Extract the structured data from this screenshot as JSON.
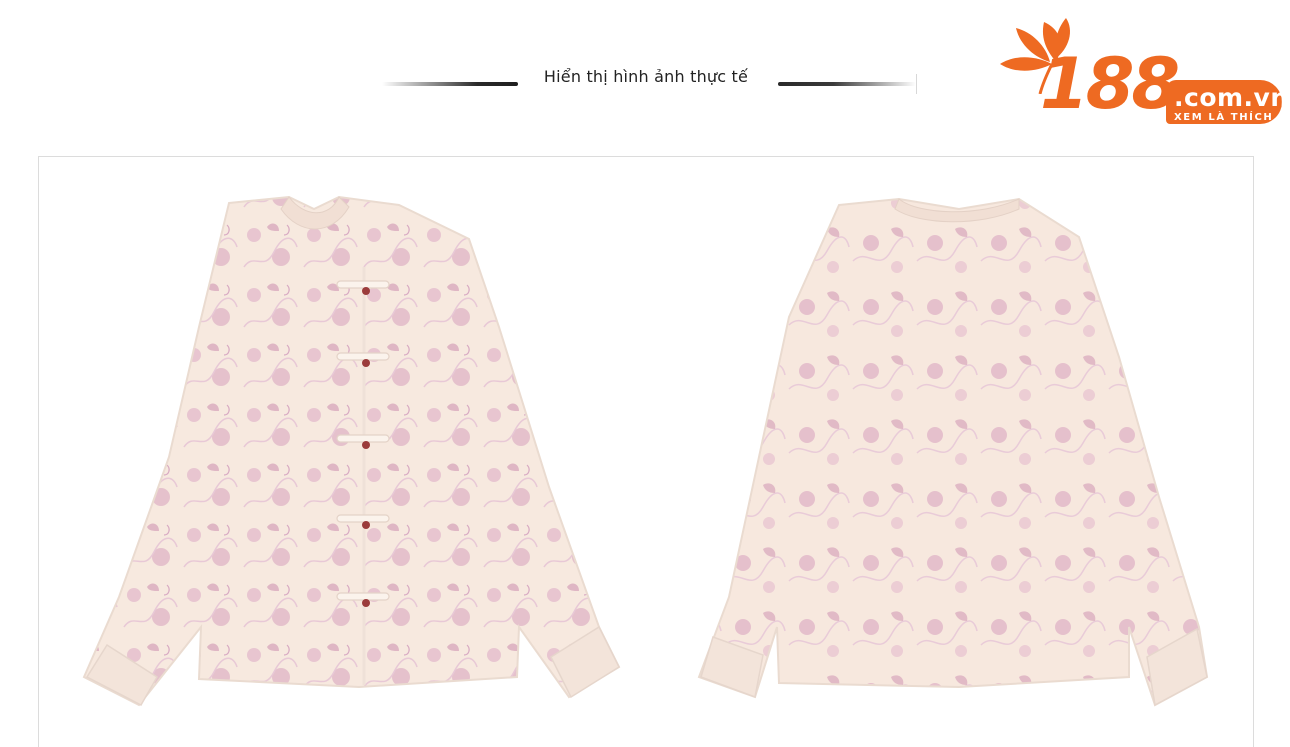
{
  "header": {
    "title": "Hiển thị hình ảnh thực tế"
  },
  "logo": {
    "number": "188",
    "domain": ".com.vn",
    "tagline": "XEM LÀ THÍCH",
    "brand_color": "#ee6a22"
  },
  "photo": {
    "views": [
      "front",
      "back"
    ],
    "garment_color": "#f6e6dc",
    "embroidery_color": "#c98fb0",
    "button_color": "#9b3b3b"
  }
}
